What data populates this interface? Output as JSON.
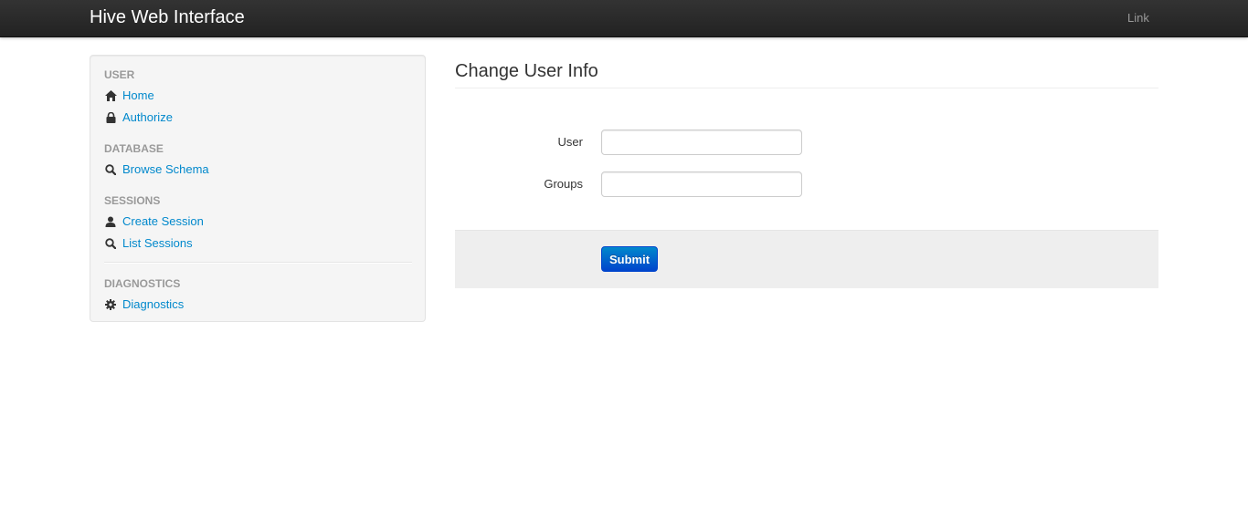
{
  "navbar": {
    "brand": "Hive Web Interface",
    "link": "Link"
  },
  "sidebar": {
    "sections": [
      {
        "header": "USER",
        "items": [
          {
            "label": "Home",
            "icon": "home-icon"
          },
          {
            "label": "Authorize",
            "icon": "lock-icon"
          }
        ]
      },
      {
        "header": "DATABASE",
        "items": [
          {
            "label": "Browse Schema",
            "icon": "search-icon"
          }
        ]
      },
      {
        "header": "SESSIONS",
        "items": [
          {
            "label": "Create Session",
            "icon": "user-icon"
          },
          {
            "label": "List Sessions",
            "icon": "search-icon"
          }
        ]
      },
      {
        "header": "DIAGNOSTICS",
        "items": [
          {
            "label": "Diagnostics",
            "icon": "gear-icon"
          }
        ]
      }
    ]
  },
  "main": {
    "title": "Change User Info",
    "form": {
      "user_label": "User",
      "user_value": "",
      "groups_label": "Groups",
      "groups_value": "",
      "submit_label": "Submit"
    }
  },
  "colors": {
    "link": "#0088cc",
    "navbar": "#222222",
    "primary": "#0055cc"
  }
}
